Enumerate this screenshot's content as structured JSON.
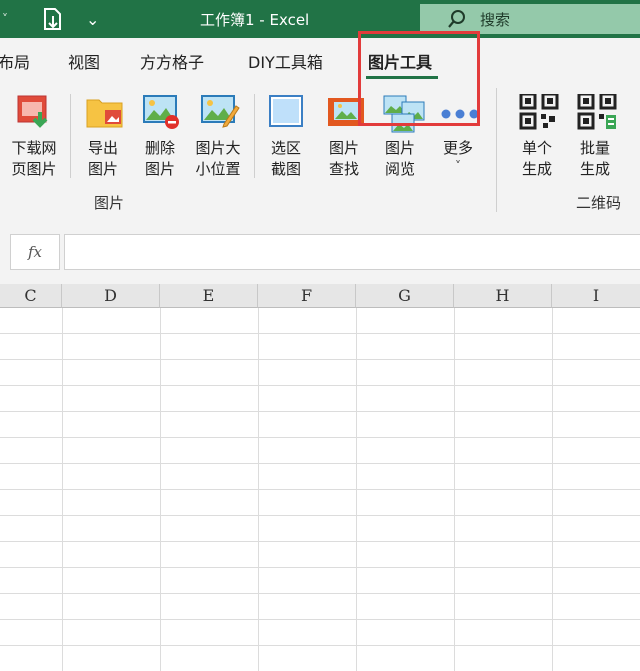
{
  "titlebar": {
    "qat_chevron": "˅",
    "qat_customize": "⌄",
    "title": "工作簿1  -  Excel",
    "search_placeholder": "搜索"
  },
  "tabs": [
    {
      "label": "布局"
    },
    {
      "label": "视图"
    },
    {
      "label": "方方格子"
    },
    {
      "label": "DIY工具箱"
    },
    {
      "label": "图片工具",
      "active": true
    }
  ],
  "ribbon": {
    "buttons": [
      {
        "label": "下载网\n页图片",
        "icon": "download-web-image-icon"
      },
      {
        "label": "导出\n图片",
        "icon": "export-image-icon"
      },
      {
        "label": "删除\n图片",
        "icon": "delete-image-icon"
      },
      {
        "label": "图片大\n小位置",
        "icon": "image-size-position-icon"
      },
      {
        "label": "选区\n截图",
        "icon": "selection-screenshot-icon"
      },
      {
        "label": "图片\n查找",
        "icon": "image-find-icon"
      },
      {
        "label": "图片\n阅览",
        "icon": "image-browse-icon"
      },
      {
        "label": "更多",
        "icon": "more-dots-icon",
        "dropdown": "˅"
      },
      {
        "label": "单个\n生成",
        "icon": "qr-single-icon"
      },
      {
        "label": "批量\n生成",
        "icon": "qr-batch-icon"
      }
    ],
    "groups": {
      "image_group": "图片",
      "qr_group": "二维码"
    }
  },
  "formula_bar": {
    "fx": "fx",
    "value": ""
  },
  "columns": [
    "C",
    "D",
    "E",
    "F",
    "G",
    "H",
    "I"
  ]
}
